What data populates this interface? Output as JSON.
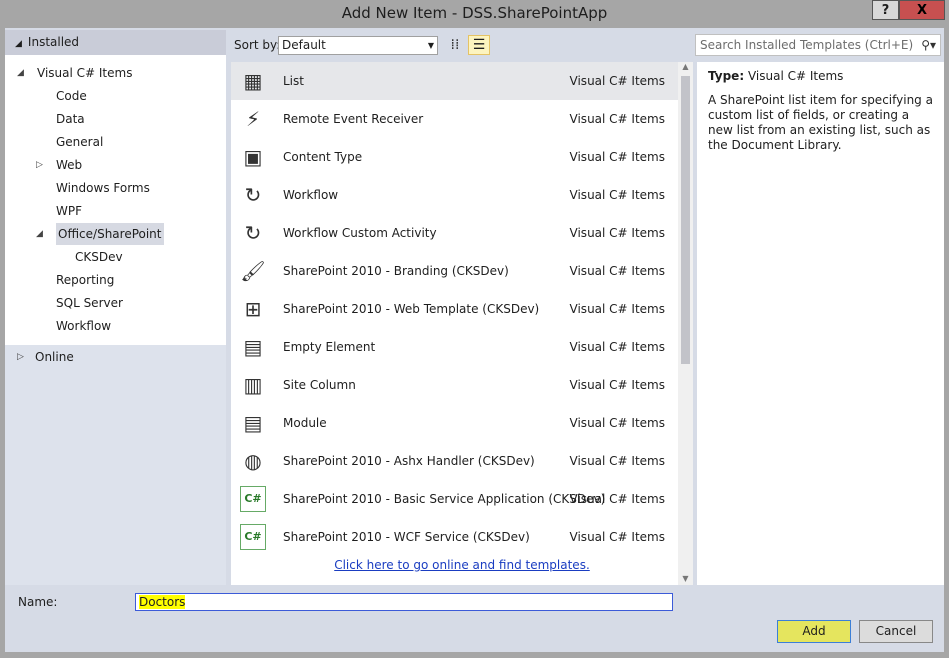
{
  "window": {
    "title": "Add New Item - DSS.SharePointApp",
    "help": "?",
    "close": "X"
  },
  "left": {
    "installed": "Installed",
    "tree": [
      {
        "label": "Visual C# Items",
        "level": 0,
        "expanded": true
      },
      {
        "label": "Code",
        "level": 1
      },
      {
        "label": "Data",
        "level": 1
      },
      {
        "label": "General",
        "level": 1
      },
      {
        "label": "Web",
        "level": 1,
        "collapsed": true
      },
      {
        "label": "Windows Forms",
        "level": 1
      },
      {
        "label": "WPF",
        "level": 1
      },
      {
        "label": "Office/SharePoint",
        "level": 1,
        "expanded": true,
        "selected": true
      },
      {
        "label": "CKSDev",
        "level": 2
      },
      {
        "label": "Reporting",
        "level": 1
      },
      {
        "label": "SQL Server",
        "level": 1
      },
      {
        "label": "Workflow",
        "level": 1
      }
    ],
    "online": "Online"
  },
  "toolbar": {
    "sort_label": "Sort by:",
    "sort_value": "Default",
    "search_placeholder": "Search Installed Templates (Ctrl+E)"
  },
  "items": [
    {
      "name": "List",
      "category": "Visual C# Items",
      "icon": "list-icon",
      "glyph": "▦"
    },
    {
      "name": "Remote Event Receiver",
      "category": "Visual C# Items",
      "icon": "event-receiver-icon",
      "glyph": "⚡"
    },
    {
      "name": "Content Type",
      "category": "Visual C# Items",
      "icon": "content-type-icon",
      "glyph": "▣"
    },
    {
      "name": "Workflow",
      "category": "Visual C# Items",
      "icon": "workflow-icon",
      "glyph": "↻"
    },
    {
      "name": "Workflow Custom Activity",
      "category": "Visual C# Items",
      "icon": "workflow-activity-icon",
      "glyph": "↻"
    },
    {
      "name": "SharePoint 2010 - Branding (CKSDev)",
      "category": "Visual C# Items",
      "icon": "paintbrush-icon",
      "glyph": "🖌"
    },
    {
      "name": "SharePoint 2010 - Web Template (CKSDev)",
      "category": "Visual C# Items",
      "icon": "web-template-icon",
      "glyph": "⊞"
    },
    {
      "name": "Empty Element",
      "category": "Visual C# Items",
      "icon": "empty-element-icon",
      "glyph": "▤"
    },
    {
      "name": "Site Column",
      "category": "Visual C# Items",
      "icon": "site-column-icon",
      "glyph": "▥"
    },
    {
      "name": "Module",
      "category": "Visual C# Items",
      "icon": "module-icon",
      "glyph": "▤"
    },
    {
      "name": "SharePoint 2010 - Ashx Handler (CKSDev)",
      "category": "Visual C# Items",
      "icon": "ashx-handler-icon",
      "glyph": "◍"
    },
    {
      "name": "SharePoint 2010 - Basic Service Application (CKSDev)",
      "category": "Visual C# Items",
      "icon": "csharp-service-icon",
      "glyph": "C#"
    },
    {
      "name": "SharePoint 2010 - WCF Service (CKSDev)",
      "category": "Visual C# Items",
      "icon": "csharp-wcf-icon",
      "glyph": "C#"
    }
  ],
  "online_link": "Click here to go online and find templates.",
  "details": {
    "type_label": "Type:",
    "type_value": "Visual C# Items",
    "description": "A SharePoint list item for specifying a custom list of fields, or creating a new list from an existing list, such as the Document Library."
  },
  "bottom": {
    "name_label": "Name:",
    "name_value": "Doctors",
    "add": "Add",
    "cancel": "Cancel"
  }
}
